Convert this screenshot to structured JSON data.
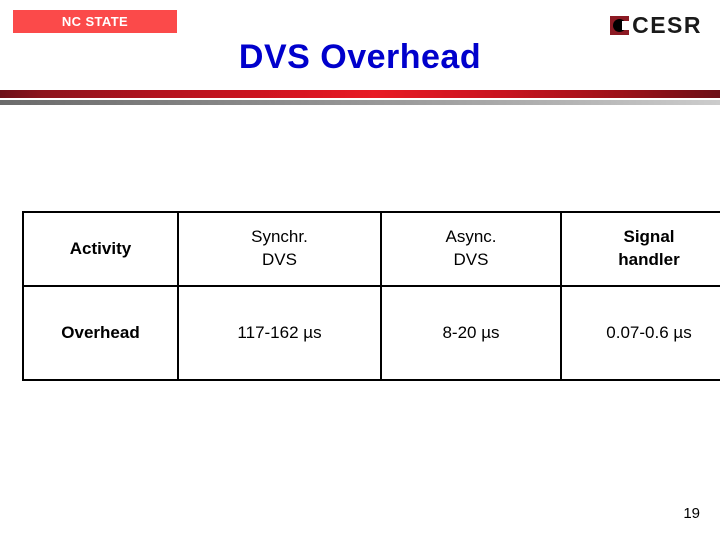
{
  "header": {
    "brand_badge": "NC STATE",
    "brand_badge_color": "#fb4a4a",
    "logo_text": "CESR",
    "logo_mark_color": "#8c1a23",
    "title": "DVS Overhead",
    "title_color": "#0000cc",
    "rule_red_color": "#d81521",
    "rule_gray_color": "#8a8a8a"
  },
  "table": {
    "columns": [
      {
        "label_line1": "Activity",
        "label_line2": "",
        "bold": true
      },
      {
        "label_line1": "Synchr.",
        "label_line2": "DVS",
        "bold": false
      },
      {
        "label_line1": "Async.",
        "label_line2": "DVS",
        "bold": false
      },
      {
        "label_line1": "Signal",
        "label_line2": "handler",
        "bold": true
      }
    ],
    "rows": [
      {
        "label": "Overhead",
        "values": [
          "117-162 µs",
          "8-20 µs",
          "0.07-0.6 µs"
        ]
      }
    ]
  },
  "footer": {
    "page_number": "19"
  }
}
